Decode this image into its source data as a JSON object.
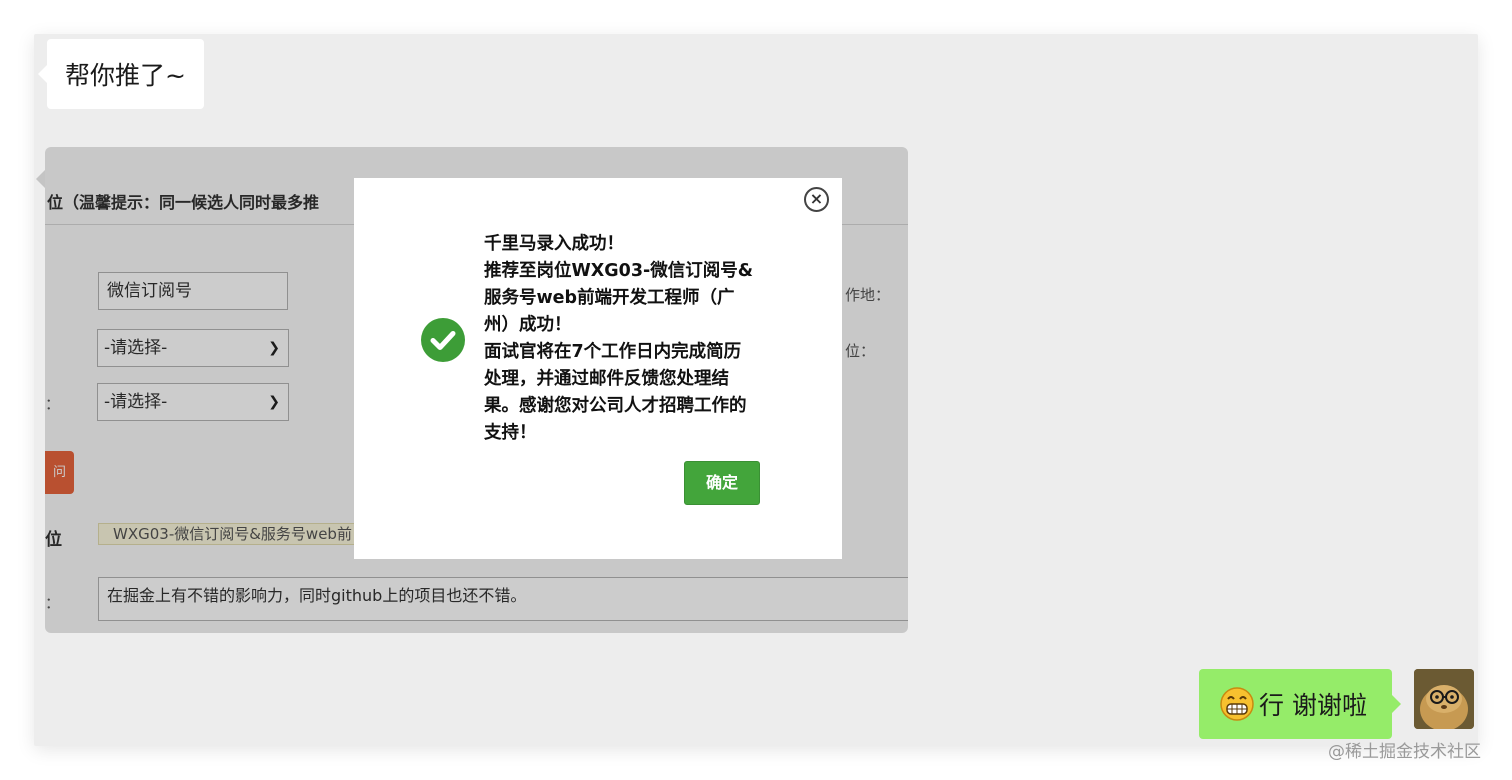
{
  "messages": {
    "incoming_text": "帮你推了~",
    "outgoing_text": "行 谢谢啦",
    "outgoing_emoji": "grinning-face-emoji"
  },
  "screenshot": {
    "header_text": "位（温馨提示：同一候选人同时最多推",
    "input_value": "微信订阅号",
    "select1_value": "-请选择-",
    "select2_value": "-请选择-",
    "right_label_1": "作地：",
    "right_label_2": "位：",
    "colon_label": "：",
    "orange_button_label": "问",
    "position_label": "位",
    "position_value": "WXG03-微信订阅号&服务号web前",
    "bottom_colon": "：",
    "recommend_text": "在掘金上有不错的影响力，同时github上的项目也还不错。"
  },
  "modal": {
    "close_glyph": "×",
    "lines": [
      "千里马录入成功！",
      "推荐至岗位WXG03-微信订阅号&",
      "服务号web前端开发工程师（广",
      "州）成功！",
      "面试官将在7个工作日内完成简历",
      "处理，并通过邮件反馈您处理结",
      "果。感谢您对公司人才招聘工作的",
      "支持！"
    ],
    "confirm_label": "确定",
    "icon": "success-check-icon"
  },
  "watermark": "@稀土掘金技术社区",
  "colors": {
    "chat_bg": "#ededed",
    "outgoing_bubble": "#95ec69",
    "confirm_green": "#43a53b",
    "orange": "#e8643c"
  }
}
